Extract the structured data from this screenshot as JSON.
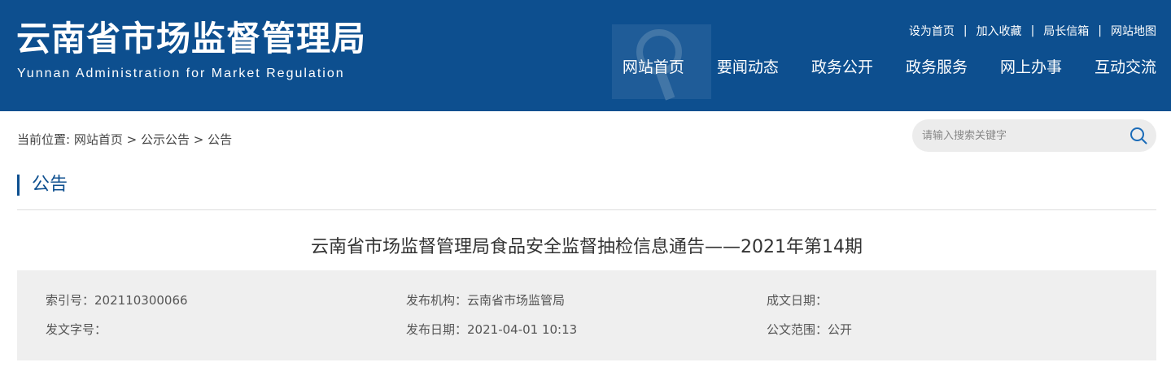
{
  "header": {
    "logo_cn": "云南省市场监督管理局",
    "logo_en": "Yunnan Administration for Market Regulation",
    "brand_color": "#0d4f8f",
    "top_links": [
      "设为首页",
      "加入收藏",
      "局长信箱",
      "网站地图"
    ],
    "separator": "|",
    "nav": [
      "网站首页",
      "要闻动态",
      "政务公开",
      "政务服务",
      "网上办事",
      "互动交流"
    ]
  },
  "breadcrumb": {
    "prefix": "当前位置:",
    "items": [
      "网站首页",
      "公示公告",
      "公告"
    ],
    "separator": ">"
  },
  "search": {
    "placeholder": "请输入搜索关键字",
    "icon": "search-icon"
  },
  "section": {
    "title": "公告"
  },
  "article": {
    "title": "云南省市场监督管理局食品安全监督抽检信息通告——2021年第14期",
    "meta": {
      "index_label": "索引号：",
      "index_value": "202110300066",
      "org_label": "发布机构：",
      "org_value": "云南省市场监管局",
      "written_label": "成文日期：",
      "written_value": "",
      "docno_label": "发文字号：",
      "docno_value": "",
      "pubdate_label": "发布日期：",
      "pubdate_value": "2021-04-01 10:13",
      "scope_label": "公文范围：",
      "scope_value": "公开"
    }
  }
}
